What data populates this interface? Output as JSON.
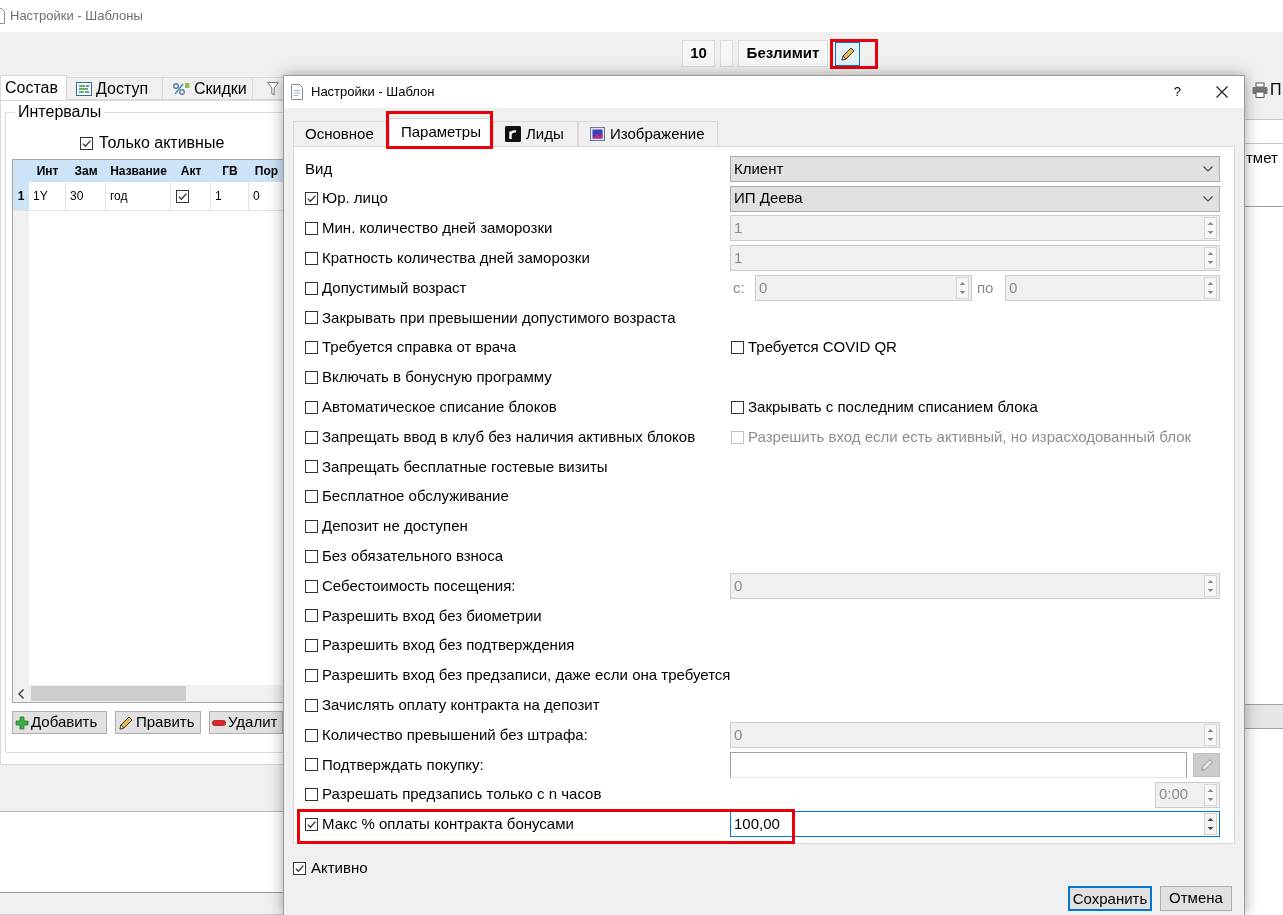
{
  "window": {
    "title": "Настройки - Шаблоны"
  },
  "toolbar": {
    "count": "10",
    "tariff": "Безлимит",
    "edit_button": {
      "highlighted": true
    }
  },
  "tabs": [
    {
      "label": "Состав",
      "selected": true
    },
    {
      "label": "Доступ",
      "selected": false
    },
    {
      "label": "Скидки",
      "selected": false
    },
    {
      "selected": false
    }
  ],
  "print_button": {
    "label": "П"
  },
  "side_column": {
    "header": "тмет"
  },
  "intervals": {
    "title": "Интервалы",
    "only_active": {
      "label": "Только активные",
      "checked": true
    },
    "table": {
      "columns": [
        "Инт",
        "Зам",
        "Название",
        "Акт",
        "ГВ",
        "Пор"
      ],
      "rows": [
        {
          "header": "1",
          "cells": [
            {
              "kind": "text",
              "text": "1Y"
            },
            {
              "kind": "text",
              "text": "30"
            },
            {
              "kind": "text",
              "text": "год"
            },
            {
              "kind": "check",
              "checked": true
            },
            {
              "kind": "text",
              "text": "1"
            },
            {
              "kind": "text",
              "text": "0"
            }
          ]
        }
      ]
    },
    "buttons": [
      "Добавить",
      "Править",
      "Удалит"
    ]
  },
  "dialog": {
    "title": "Настройки - Шаблон",
    "help": "?",
    "tabs": [
      {
        "label": "Основное",
        "selected": false,
        "highlighted": false
      },
      {
        "label": "Параметры",
        "selected": true,
        "highlighted": true
      },
      {
        "label": "Лиды",
        "selected": false,
        "highlighted": false
      },
      {
        "label": "Изображение",
        "selected": false,
        "highlighted": false
      }
    ],
    "rows": [
      {
        "kind": "label",
        "label": "Вид",
        "highlighted": false,
        "field": {
          "kind": "combo",
          "value": "Клиент"
        }
      },
      {
        "kind": "check",
        "label": "Юр. лицо",
        "checked": true,
        "highlighted": false,
        "field": {
          "kind": "combo",
          "value": "ИП Деева"
        }
      },
      {
        "kind": "check",
        "label": "Мин. количество дней заморозки",
        "checked": false,
        "highlighted": false,
        "field": {
          "kind": "spin",
          "value": "1",
          "disabled": true,
          "focused": false
        }
      },
      {
        "kind": "check",
        "label": "Кратность количества дней заморозки",
        "checked": false,
        "highlighted": false,
        "field": {
          "kind": "spin",
          "value": "1",
          "disabled": true,
          "focused": false
        }
      },
      {
        "kind": "check",
        "label": "Допустимый возраст",
        "checked": false,
        "highlighted": false,
        "field": {
          "kind": "range",
          "from_label": "с:",
          "from": "0",
          "to_label": "по",
          "to": "0",
          "disabled": true
        }
      },
      {
        "kind": "check",
        "label": "Закрывать при превышении допустимого возраста",
        "checked": false,
        "highlighted": false
      },
      {
        "kind": "check",
        "label": "Требуется справка от врача",
        "checked": false,
        "highlighted": false,
        "field": {
          "kind": "check",
          "label": "Требуется COVID QR",
          "checked": false,
          "disabled": false
        }
      },
      {
        "kind": "check",
        "label": "Включать в бонусную программу",
        "checked": false,
        "highlighted": false
      },
      {
        "kind": "check",
        "label": "Автоматическое списание блоков",
        "checked": false,
        "highlighted": false,
        "field": {
          "kind": "check",
          "label": "Закрывать с последним списанием блока",
          "checked": false,
          "disabled": false
        }
      },
      {
        "kind": "check",
        "label": "Запрещать ввод в клуб без наличия активных блоков",
        "checked": false,
        "highlighted": false,
        "field": {
          "kind": "check",
          "label": "Разрешить вход если есть активный, но израсходованный блок",
          "checked": false,
          "disabled": true
        }
      },
      {
        "kind": "check",
        "label": "Запрещать бесплатные гостевые визиты",
        "checked": false,
        "highlighted": false
      },
      {
        "kind": "check",
        "label": "Бесплатное обслуживание",
        "checked": false,
        "highlighted": false
      },
      {
        "kind": "check",
        "label": "Депозит не доступен",
        "checked": false,
        "highlighted": false
      },
      {
        "kind": "check",
        "label": "Без обязательного взноса",
        "checked": false,
        "highlighted": false
      },
      {
        "kind": "check",
        "label": "Себестоимость посещения:",
        "checked": false,
        "highlighted": false,
        "field": {
          "kind": "spin",
          "value": "0",
          "disabled": true,
          "focused": false
        }
      },
      {
        "kind": "check",
        "label": "Разрешить вход без биометрии",
        "checked": false,
        "highlighted": false
      },
      {
        "kind": "check",
        "label": "Разрешить вход без подтверждения",
        "checked": false,
        "highlighted": false
      },
      {
        "kind": "check",
        "label": "Разрешить вход без предзаписи, даже если она требуется",
        "checked": false,
        "highlighted": false
      },
      {
        "kind": "check",
        "label": "Зачислять оплату контракта на депозит",
        "checked": false,
        "highlighted": false
      },
      {
        "kind": "check",
        "label": "Количество превышений без штрафа:",
        "checked": false,
        "highlighted": false,
        "field": {
          "kind": "spin",
          "value": "0",
          "disabled": true,
          "focused": false
        }
      },
      {
        "kind": "check",
        "label": "Подтверждать покупку:",
        "checked": false,
        "highlighted": false,
        "field": {
          "kind": "picker",
          "button_disabled": true
        }
      },
      {
        "kind": "check",
        "label": "Разрешать предзапись только с n часов",
        "checked": false,
        "highlighted": false,
        "field": {
          "kind": "time",
          "value": "0:00",
          "disabled": true
        }
      },
      {
        "kind": "check",
        "label": "Макс % оплаты контракта бонусами",
        "checked": true,
        "highlighted": true,
        "field": {
          "kind": "spin",
          "value": "100,00",
          "disabled": false,
          "focused": true
        }
      }
    ],
    "active": {
      "label": "Активно",
      "checked": true
    },
    "buttons": [
      {
        "label": "Сохранить",
        "default": true
      },
      {
        "label": "Отмена",
        "default": false
      }
    ]
  }
}
